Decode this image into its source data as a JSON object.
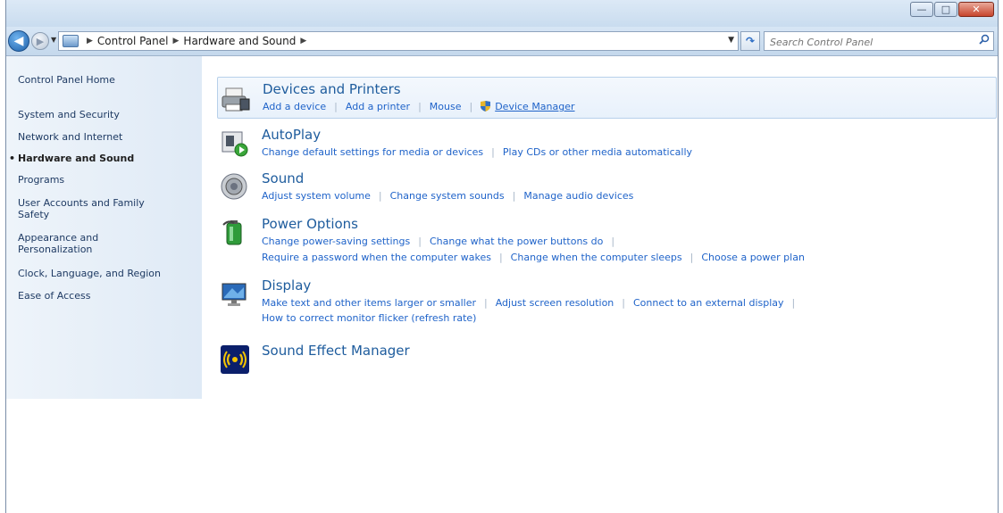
{
  "window": {
    "caption_buttons": {
      "minimize": "—",
      "maximize": "□",
      "close": "✕"
    }
  },
  "navbar": {
    "breadcrumb": [
      "Control Panel",
      "Hardware and Sound"
    ],
    "search_placeholder": "Search Control Panel"
  },
  "sidebar": {
    "items": [
      {
        "label": "Control Panel Home",
        "current": false
      },
      {
        "label": "System and Security",
        "current": false
      },
      {
        "label": "Network and Internet",
        "current": false
      },
      {
        "label": "Hardware and Sound",
        "current": true
      },
      {
        "label": "Programs",
        "current": false
      },
      {
        "label": "User Accounts and Family Safety",
        "current": false
      },
      {
        "label": "Appearance and Personalization",
        "current": false
      },
      {
        "label": "Clock, Language, and Region",
        "current": false
      },
      {
        "label": "Ease of Access",
        "current": false
      }
    ]
  },
  "categories": [
    {
      "title": "Devices and Printers",
      "icon": "printer-icon",
      "links": [
        "Add a device",
        "Add a printer",
        "Mouse",
        "Device Manager"
      ]
    },
    {
      "title": "AutoPlay",
      "icon": "autoplay-icon",
      "links": [
        "Change default settings for media or devices",
        "Play CDs or other media automatically"
      ]
    },
    {
      "title": "Sound",
      "icon": "speaker-icon",
      "links": [
        "Adjust system volume",
        "Change system sounds",
        "Manage audio devices"
      ]
    },
    {
      "title": "Power Options",
      "icon": "battery-icon",
      "links": [
        "Change power-saving settings",
        "Change what the power buttons do"
      ],
      "links2": [
        "Require a password when the computer wakes",
        "Change when the computer sleeps",
        "Choose a power plan"
      ]
    },
    {
      "title": "Display",
      "icon": "monitor-icon",
      "links": [
        "Make text and other items larger or smaller",
        "Adjust screen resolution",
        "Connect to an external display"
      ],
      "links2": [
        "How to correct monitor flicker (refresh rate)"
      ]
    },
    {
      "title": "Sound Effect Manager",
      "icon": "sound-effect-icon",
      "links": []
    }
  ]
}
